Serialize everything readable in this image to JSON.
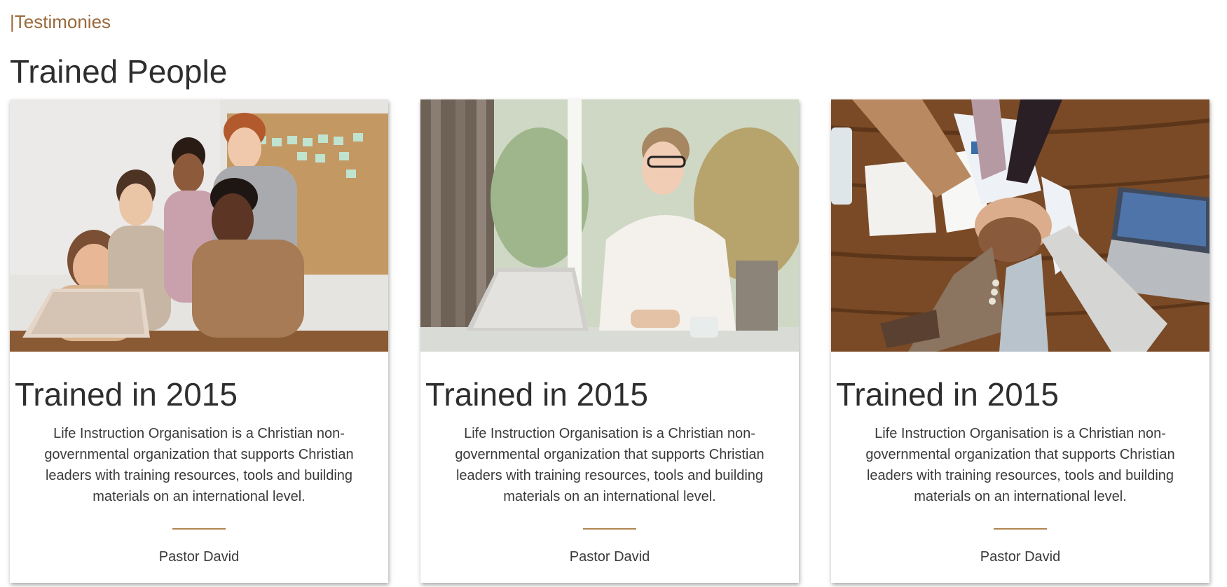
{
  "section": {
    "label": "|Testimonies",
    "title": "Trained People"
  },
  "cards": [
    {
      "image": "team-around-laptop-photo",
      "heading": "Trained in 2015",
      "text": "Life Instruction Organisation is a Christian non-governmental organization that supports Christian leaders with training resources, tools and building materials on an international level.",
      "author": "Pastor David"
    },
    {
      "image": "smiling-woman-at-desk-photo",
      "heading": "Trained in 2015",
      "text": "Life Instruction Organisation is a Christian non-governmental organization that supports Christian leaders with training resources, tools and building materials on an international level.",
      "author": "Pastor David"
    },
    {
      "image": "stacked-hands-teamwork-photo",
      "heading": "Trained in 2015",
      "text": "Life Instruction Organisation is a Christian non-governmental organization that supports Christian leaders with training resources, tools and building materials on an international level.",
      "author": "Pastor David"
    }
  ],
  "colors": {
    "accent": "#9a6a3c",
    "divider": "#b08450",
    "heading": "#2e2e2e",
    "body_text": "#3a3a3a"
  }
}
